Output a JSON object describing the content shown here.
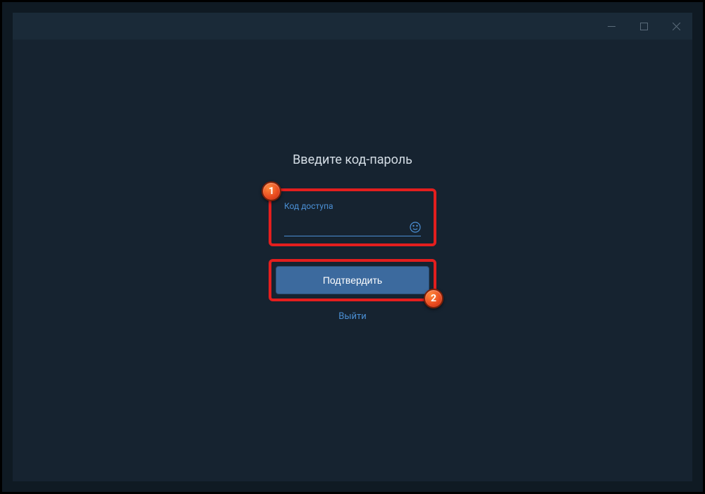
{
  "heading": "Введите код-пароль",
  "input": {
    "label": "Код доступа",
    "value": ""
  },
  "confirm_button": "Подтвердить",
  "logout_link": "Выйти",
  "badges": {
    "one": "1",
    "two": "2"
  }
}
